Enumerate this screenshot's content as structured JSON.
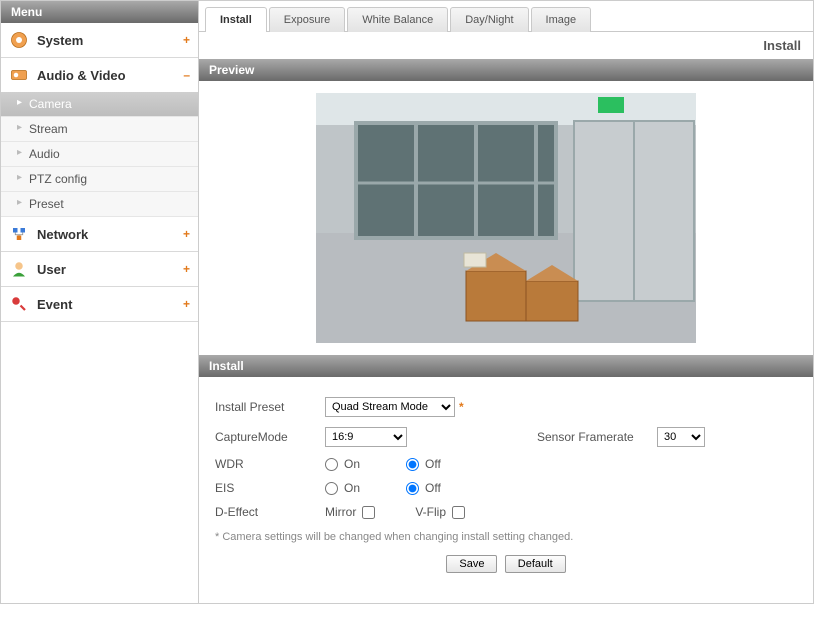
{
  "menu": {
    "header": "Menu",
    "groups": [
      {
        "label": "System",
        "toggle": "+",
        "icon": "gear"
      },
      {
        "label": "Audio & Video",
        "toggle": "–",
        "icon": "av"
      },
      {
        "label": "Network",
        "toggle": "+",
        "icon": "network"
      },
      {
        "label": "User",
        "toggle": "+",
        "icon": "user"
      },
      {
        "label": "Event",
        "toggle": "+",
        "icon": "event"
      }
    ],
    "av_submenu": [
      "Camera",
      "Stream",
      "Audio",
      "PTZ config",
      "Preset"
    ]
  },
  "tabs": [
    "Install",
    "Exposure",
    "White Balance",
    "Day/Night",
    "Image"
  ],
  "breadcrumb": "Install",
  "sections": {
    "preview": "Preview",
    "install": "Install"
  },
  "form": {
    "installPreset_label": "Install Preset",
    "installPreset_value": "Quad Stream Mode",
    "captureMode_label": "CaptureMode",
    "captureMode_value": "16:9",
    "sensorFramerate_label": "Sensor Framerate",
    "sensorFramerate_value": "30",
    "wdr_label": "WDR",
    "eis_label": "EIS",
    "on": "On",
    "off": "Off",
    "deffect_label": "D-Effect",
    "mirror": "Mirror",
    "vflip": "V-Flip",
    "note": "* Camera settings will be changed when changing install setting changed.",
    "save": "Save",
    "default": "Default"
  }
}
